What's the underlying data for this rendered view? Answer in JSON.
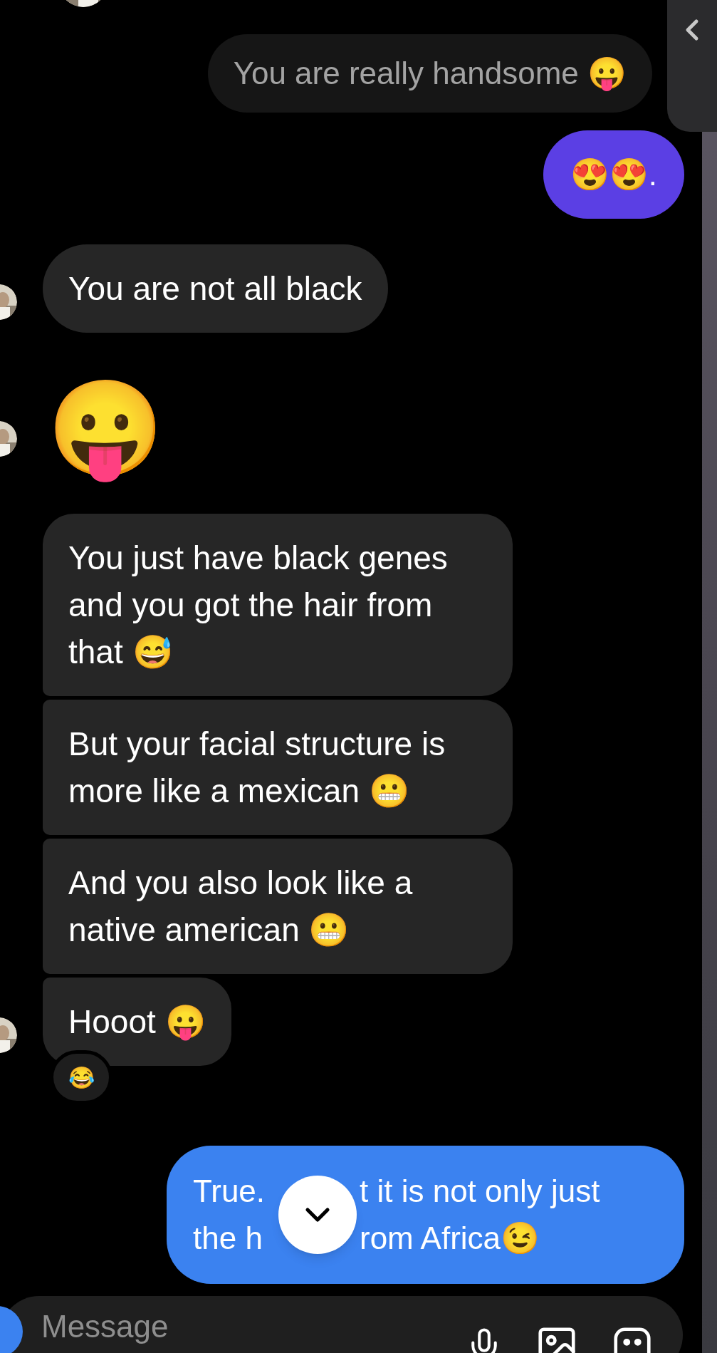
{
  "messages": [
    {
      "kind": "quote",
      "text": "You are really handsome 😛"
    },
    {
      "kind": "sent",
      "text": "😍😍.",
      "color": "#5b3fe4"
    },
    {
      "kind": "received",
      "text": "You are not all black",
      "avatar": true
    },
    {
      "kind": "emoji",
      "text": "😛",
      "avatar": true
    },
    {
      "kind": "received",
      "text": "You just have black genes and you got the hair from that 😅",
      "avatar": false
    },
    {
      "kind": "received",
      "text": "But your facial structure is more like a mexican 😬",
      "avatar": false
    },
    {
      "kind": "received",
      "text": "And you also look like a native american 😬",
      "avatar": false
    },
    {
      "kind": "received",
      "text": "Hooot 😛",
      "avatar": true,
      "reaction": "😂"
    },
    {
      "kind": "sent_covered",
      "color": "#3b82f0",
      "lines": [
        {
          "before": "True.",
          "after": "t it is not only just"
        },
        {
          "before": "the h",
          "after": "rom Africa😉"
        }
      ]
    }
  ],
  "composer": {
    "placeholder": "Message"
  }
}
